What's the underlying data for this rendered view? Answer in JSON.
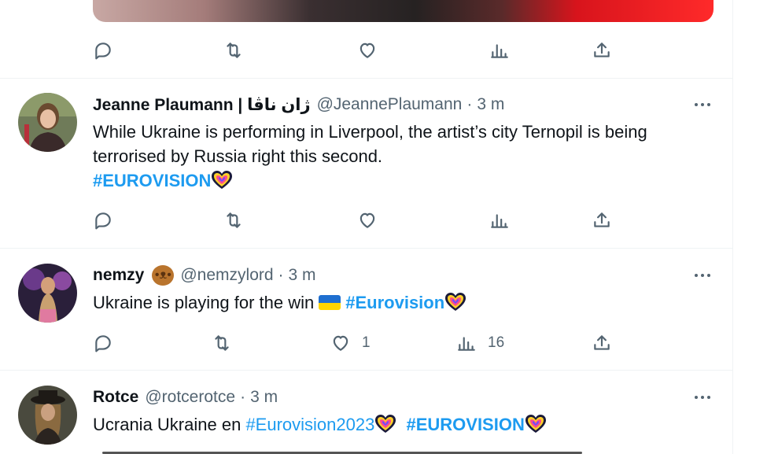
{
  "icons": {
    "reply": "reply-icon",
    "retweet": "retweet-icon",
    "like": "heart-icon",
    "views": "views-icon",
    "share": "share-icon",
    "more": "more-icon"
  },
  "colors": {
    "link": "#1d9bf0",
    "muted": "#536471",
    "text": "#0f1419",
    "divider": "#eff3f4"
  },
  "tweets": [
    {
      "name": "Jeanne Plaumann | ژان ناڤا",
      "handle": "@JeannePlaumann",
      "dot": "·",
      "time": "3 m",
      "text_line1": "While Ukraine is performing in Liverpool, the artist’s city Ternopil is being",
      "text_line2": "terrorised by Russia right this second.",
      "hashtag": "#EUROVISION"
    },
    {
      "name": "nemzy",
      "handle": "@nemzylord",
      "dot": "·",
      "time": "3 m",
      "text": "Ukraine is playing for the win",
      "hashtag": "#Eurovision",
      "likes": "1",
      "views": "16"
    },
    {
      "name": "Rotce",
      "handle": "@rotcerotce",
      "dot": "·",
      "time": "3 m",
      "text": "Ucrania Ukraine en",
      "hashtag1": "#Eurovision2023",
      "hashtag2": "#EUROVISION"
    }
  ]
}
